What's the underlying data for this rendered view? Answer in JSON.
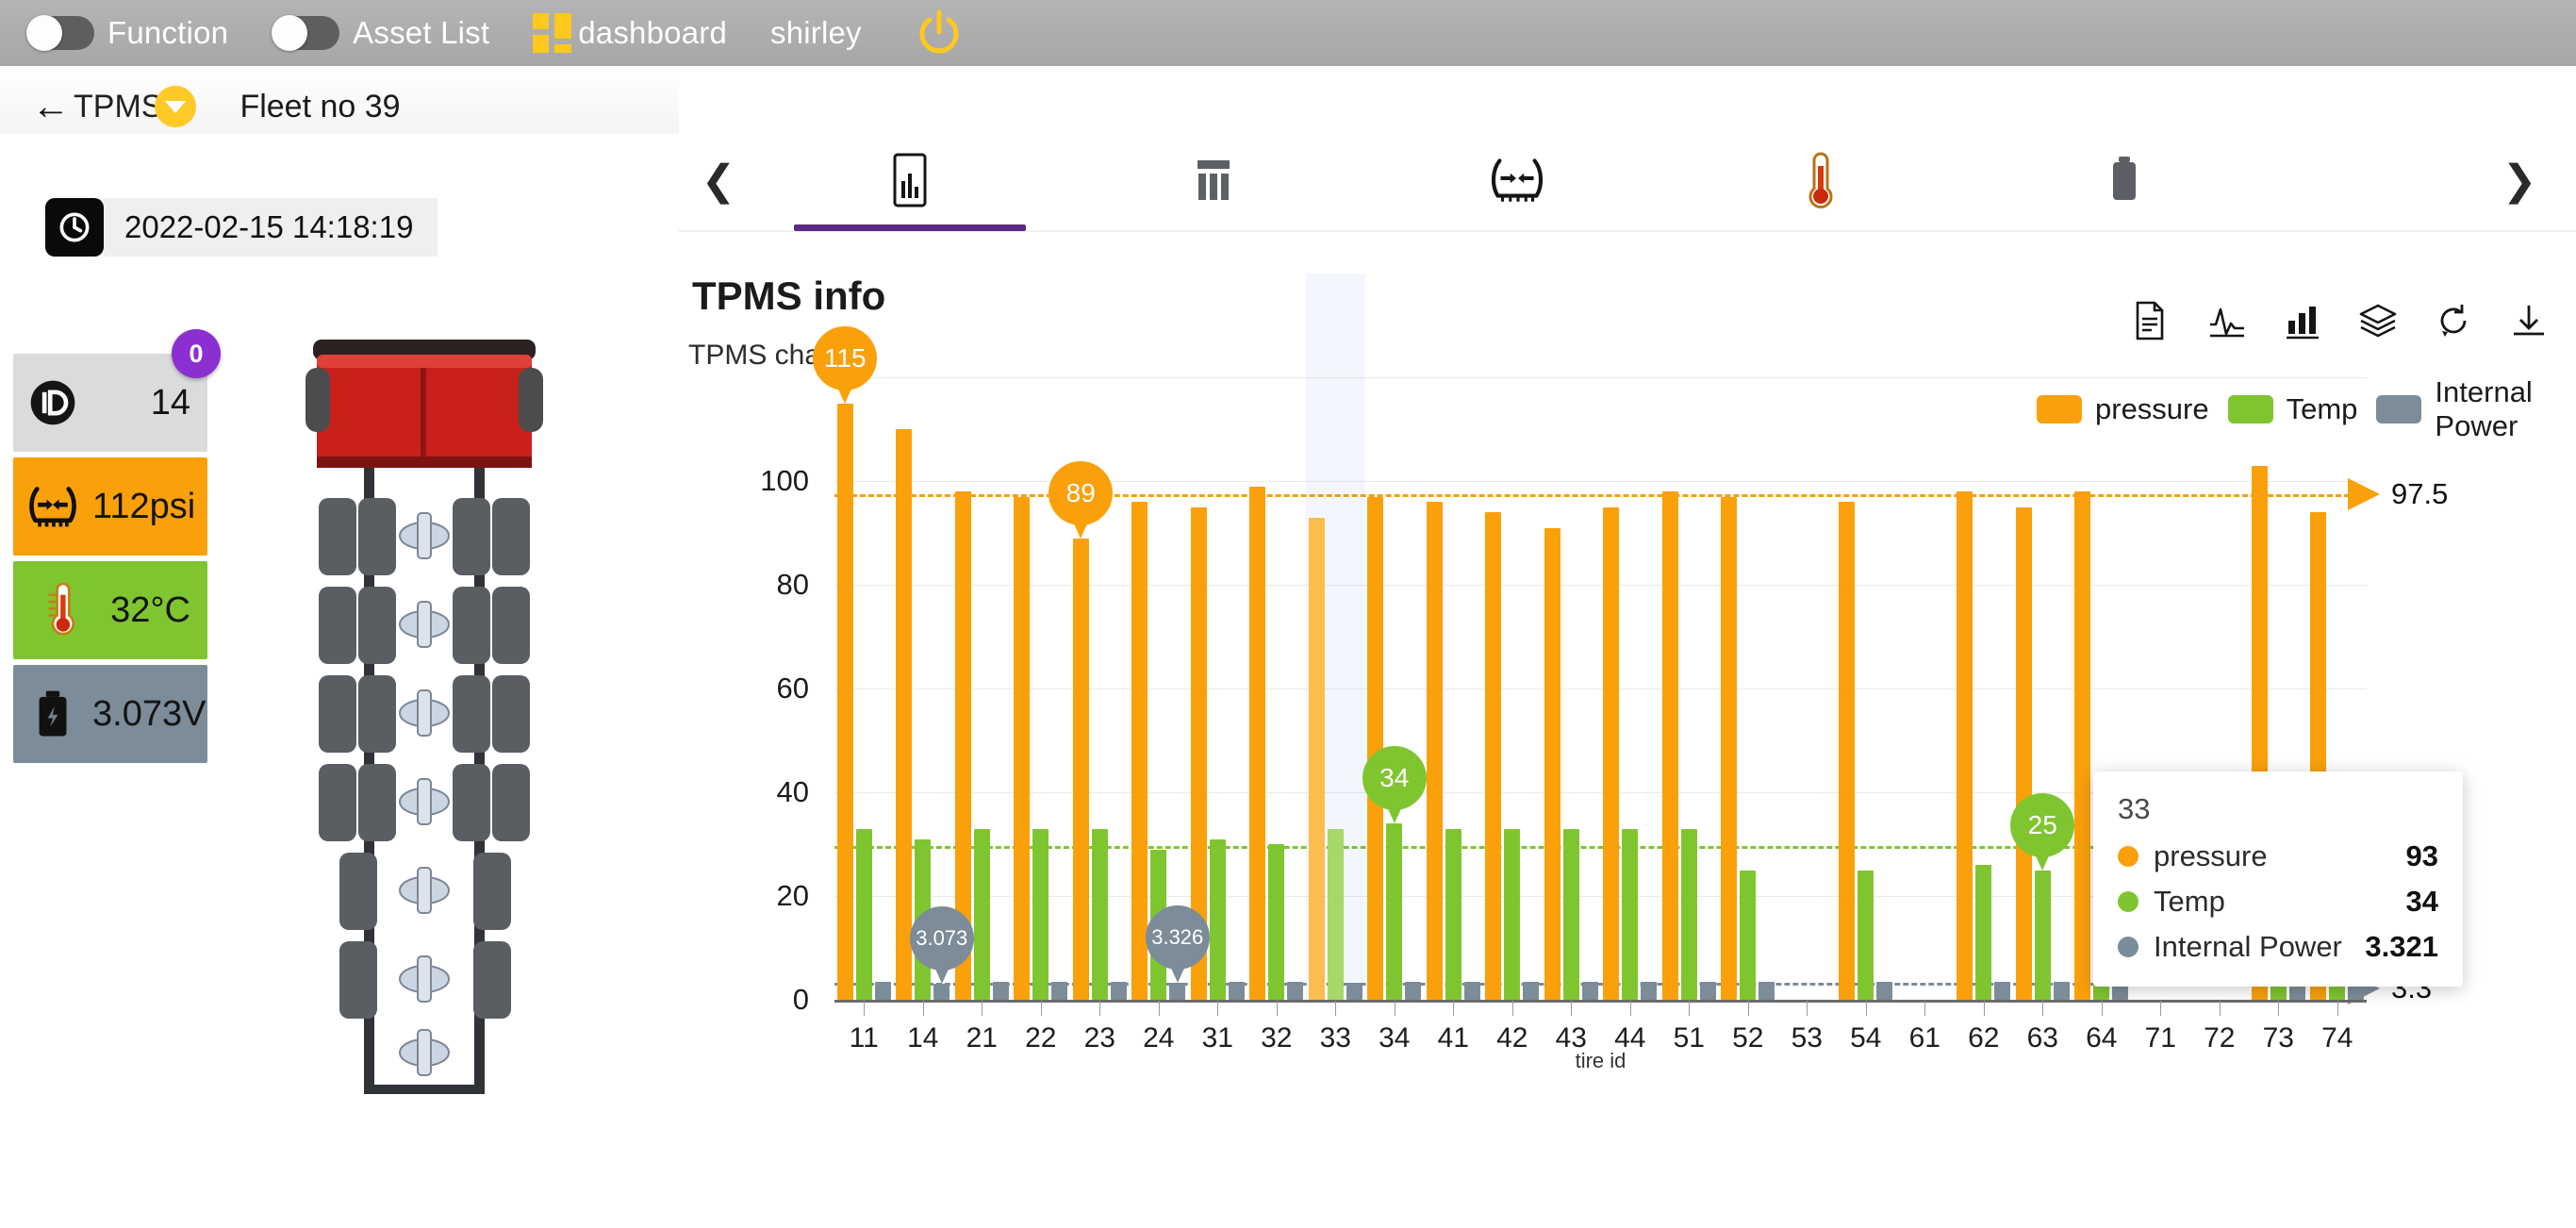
{
  "topbar": {
    "toggles": [
      {
        "label": "Function",
        "name": "function-toggle",
        "state": "off"
      },
      {
        "label": "Asset List",
        "name": "asset-list-toggle",
        "state": "off"
      }
    ],
    "brand": "dashboard",
    "user": "shirley",
    "power_icon": "power-icon",
    "bg": "#ababab",
    "accent": "#ffc81e"
  },
  "breadcrumb": {
    "back_icon": "back-arrow-icon",
    "parent": "TPMS",
    "dropdown_icon": "chevron-down-icon",
    "current": "Fleet no 39"
  },
  "timestamp": {
    "icon": "clock-icon",
    "value": "2022-02-15 14:18:19"
  },
  "cards": [
    {
      "name": "id-card",
      "icon": "id-icon",
      "value": "14",
      "bg": "#d9dbdc",
      "badge": "0"
    },
    {
      "name": "pressure-card",
      "icon": "tire-pressure-icon",
      "value": "112psi",
      "bg": "#f9a00b"
    },
    {
      "name": "temperature-card",
      "icon": "thermometer-icon",
      "value": "32°C",
      "bg": "#7fc530"
    },
    {
      "name": "voltage-card",
      "icon": "battery-icon",
      "value": "3.073V",
      "bg": "#7c8c99"
    }
  ],
  "tabs": {
    "prev_icon": "chevron-left-icon",
    "next_icon": "chevron-right-icon",
    "items": [
      {
        "name": "tab-chart",
        "icon": "bar-chart-report-icon",
        "active": true
      },
      {
        "name": "tab-table",
        "icon": "table-icon",
        "active": false
      },
      {
        "name": "tab-pressure",
        "icon": "tire-pressure-icon",
        "active": false
      },
      {
        "name": "tab-temperature",
        "icon": "thermometer-icon",
        "active": false
      },
      {
        "name": "tab-battery",
        "icon": "battery-icon",
        "active": false
      }
    ]
  },
  "panel": {
    "title": "TPMS info",
    "subtitle": "TPMS chart",
    "toolbar": [
      {
        "name": "document-icon",
        "title": "Data view"
      },
      {
        "name": "line-chart-icon",
        "title": "Line chart"
      },
      {
        "name": "bar-chart-icon",
        "title": "Bar chart"
      },
      {
        "name": "stack-icon",
        "title": "Stack"
      },
      {
        "name": "refresh-icon",
        "title": "Restore"
      },
      {
        "name": "download-icon",
        "title": "Save as image"
      }
    ]
  },
  "tooltip": {
    "title": "33",
    "rows": [
      {
        "name": "pressure",
        "value": "93",
        "color": "#f9a00b"
      },
      {
        "name": "Temp",
        "value": "34",
        "color": "#7fc530"
      },
      {
        "name": "Internal Power",
        "value": "3.321",
        "color": "#7c8c99"
      }
    ]
  },
  "chart_data": {
    "type": "bar",
    "title": "TPMS info",
    "subtitle": "TPMS chart",
    "xlabel": "tire id",
    "ylabel": "",
    "ylim": [
      0,
      120
    ],
    "yticks": [
      0,
      20,
      40,
      60,
      80,
      100
    ],
    "grid": true,
    "legend_position": "top-right",
    "categories": [
      "11",
      "14",
      "21",
      "22",
      "23",
      "24",
      "31",
      "32",
      "33",
      "34",
      "41",
      "42",
      "43",
      "44",
      "51",
      "52",
      "53",
      "54",
      "61",
      "62",
      "63",
      "64",
      "71",
      "72",
      "73",
      "74"
    ],
    "series": [
      {
        "name": "pressure",
        "color": "#f9a00b",
        "values": [
          115,
          110,
          98,
          97,
          89,
          96,
          95,
          99,
          93,
          97,
          96,
          94,
          91,
          95,
          98,
          97,
          null,
          96,
          null,
          98,
          95,
          98,
          null,
          null,
          103,
          94
        ]
      },
      {
        "name": "Temp",
        "color": "#7fc530",
        "values": [
          33,
          31,
          33,
          33,
          33,
          29,
          31,
          30,
          33,
          34,
          33,
          33,
          33,
          33,
          33,
          25,
          null,
          25,
          null,
          26,
          25,
          26,
          null,
          null,
          26,
          24
        ]
      },
      {
        "name": "Internal Power",
        "color": "#7c8c99",
        "values": [
          3.5,
          3.073,
          3.5,
          3.5,
          3.5,
          3.326,
          3.5,
          3.5,
          3.321,
          3.5,
          3.5,
          3.5,
          3.5,
          3.5,
          3.5,
          3.5,
          null,
          3.5,
          null,
          3.5,
          3.5,
          3.5,
          null,
          null,
          3.5,
          3.5
        ]
      }
    ],
    "annotations": [
      {
        "category": "11",
        "series": "pressure",
        "label": "115",
        "type": "max-pin"
      },
      {
        "category": "23",
        "series": "pressure",
        "label": "89",
        "type": "min-pin"
      },
      {
        "category": "34",
        "series": "Temp",
        "label": "34",
        "type": "max-pin"
      },
      {
        "category": "63",
        "series": "Temp",
        "label": "25",
        "type": "min-pin"
      },
      {
        "category": "14",
        "series": "Internal Power",
        "label": "3.073",
        "type": "min-pin"
      },
      {
        "category": "24",
        "series": "Internal Power",
        "label": "3.326",
        "type": "max-pin"
      }
    ],
    "average_lines": [
      {
        "series": "pressure",
        "value": 97.5,
        "label": "97.5",
        "color": "#f9a00b"
      },
      {
        "series": "Temp",
        "value": 29.6,
        "label": "29.6",
        "color": "#7fc530"
      },
      {
        "series": "Internal Power",
        "value": 3.3,
        "label": "3.3",
        "color": "#7c8c99"
      }
    ]
  }
}
